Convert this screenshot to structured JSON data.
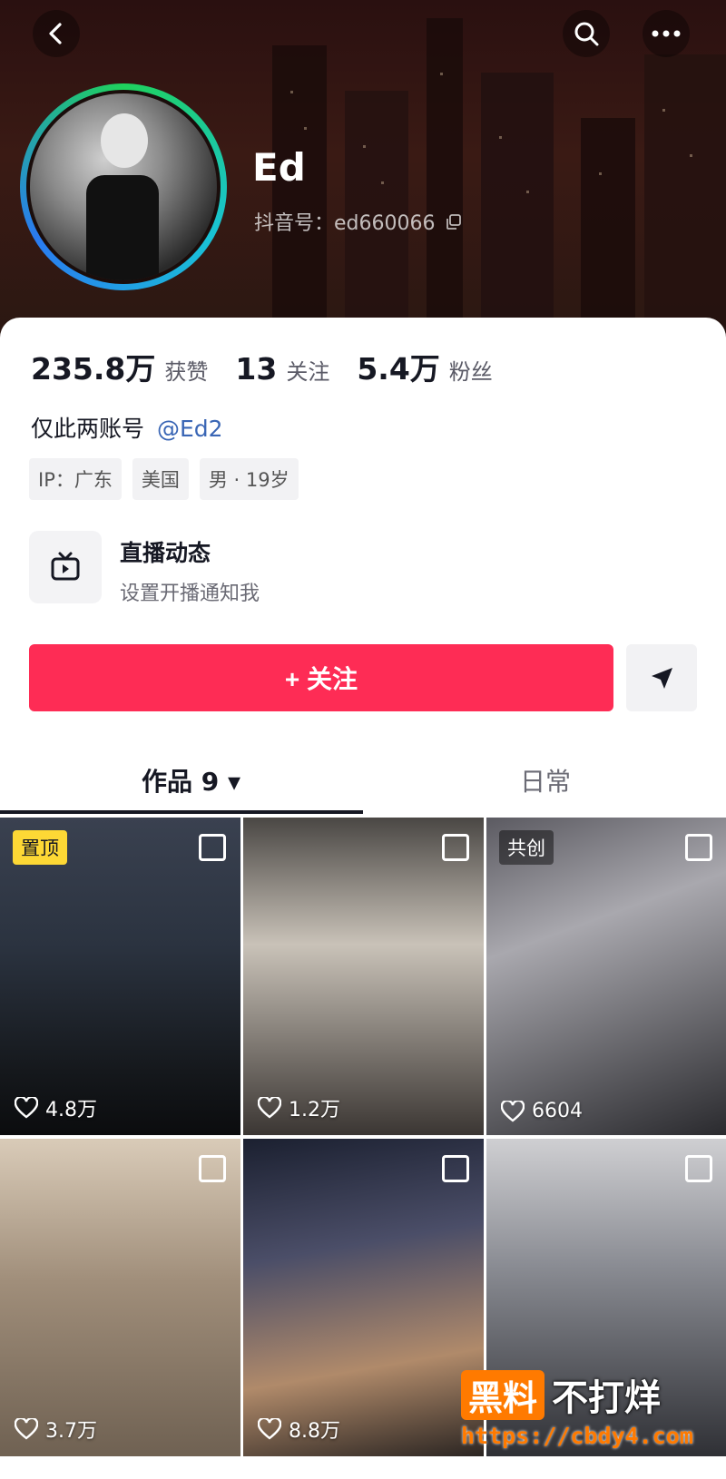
{
  "profile": {
    "name": "Ed",
    "douyin_id": "抖音号：ed660066"
  },
  "stats": [
    {
      "value": "235.8万",
      "label": "获赞"
    },
    {
      "value": "13",
      "label": "关注"
    },
    {
      "value": "5.4万",
      "label": "粉丝"
    }
  ],
  "bio": {
    "text": "仅此两账号",
    "mention": "@Ed2"
  },
  "tags": [
    "IP：广东",
    "美国",
    "男 · 19岁"
  ],
  "live": {
    "title": "直播动态",
    "subtitle": "设置开播通知我"
  },
  "actions": {
    "follow_label": "+ 关注"
  },
  "tabs": [
    {
      "label": "作品 9 ▾"
    },
    {
      "label": "日常"
    }
  ],
  "videos": [
    {
      "likes": "4.8万",
      "badge": "置顶"
    },
    {
      "likes": "1.2万",
      "badge": ""
    },
    {
      "likes": "6604",
      "badge": "共创"
    },
    {
      "likes": "3.7万",
      "badge": ""
    },
    {
      "likes": "8.8万",
      "badge": ""
    },
    {
      "likes": "",
      "badge": ""
    }
  ],
  "watermark": {
    "brand_box": "黑料",
    "brand_text": "不打烊",
    "url": "https://cbdy4.com"
  },
  "colors": {
    "accent": "#fe2c55",
    "pin_badge": "#fdd835"
  }
}
